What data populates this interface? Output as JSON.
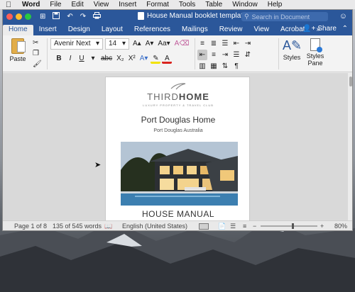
{
  "menubar": {
    "apple": "",
    "items": [
      "Word",
      "File",
      "Edit",
      "View",
      "Insert",
      "Format",
      "Tools",
      "Table",
      "Window",
      "Help"
    ]
  },
  "titlebar": {
    "title": "House Manual booklet template",
    "search_placeholder": "Search in Document",
    "qat": [
      "⊞",
      "💾",
      "↶",
      "↷",
      "🖨"
    ]
  },
  "tabs": [
    "Home",
    "Insert",
    "Design",
    "Layout",
    "References",
    "Mailings",
    "Review",
    "View",
    "Acrobat"
  ],
  "tabs_more": "»",
  "share_label": "Share",
  "ribbon": {
    "paste_label": "Paste",
    "font_name": "Avenir Next",
    "font_size": "14",
    "format_buttons": [
      "B",
      "I",
      "U",
      "abc",
      "X₂",
      "X²"
    ],
    "styles_label": "Styles",
    "styles_pane_label_1": "Styles",
    "styles_pane_label_2": "Pane"
  },
  "document": {
    "logo_text_1": "THIRD",
    "logo_text_2": "HOME",
    "logo_tagline": "LUXURY PROPERTY & TRAVEL CLUB",
    "home_title": "Port Douglas Home",
    "home_subtitle": "Port Douglas Australia",
    "manual_title": "HOUSE MANUAL"
  },
  "statusbar": {
    "page": "Page 1 of 8",
    "words": "135 of 545 words",
    "language": "English (United States)",
    "zoom": "80%",
    "zoom_fraction": 0.55
  },
  "colors": {
    "brand": "#2b579a",
    "ribbon": "#f3f3f3"
  }
}
